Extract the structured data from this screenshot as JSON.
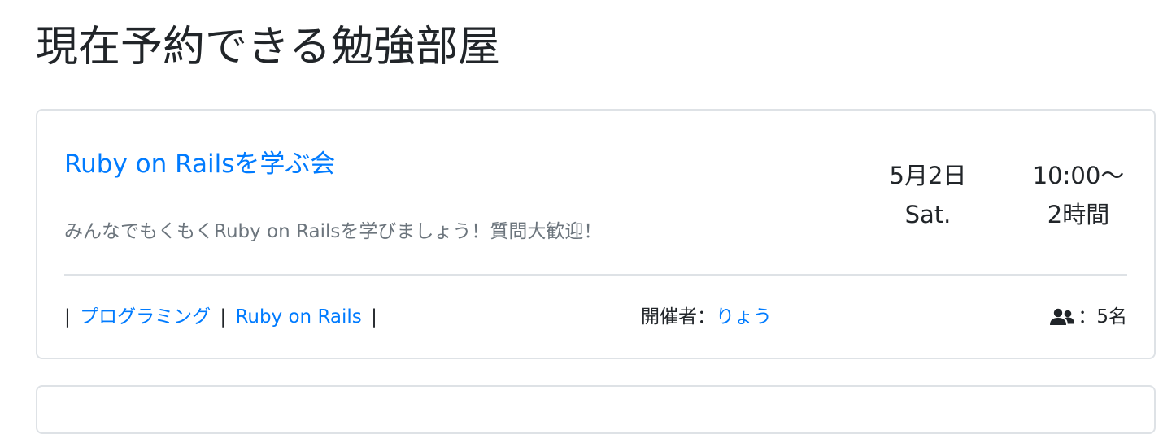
{
  "page": {
    "title": "現在予約できる勉強部屋"
  },
  "events": [
    {
      "title": "Ruby on Railsを学ぶ会",
      "description": "みんなでもくもくRuby on Railsを学びましょう！質問大歓迎！",
      "date": {
        "day": "5月2日",
        "weekday": "Sat."
      },
      "time": {
        "start": "10:00〜",
        "duration": "2時間"
      },
      "tags": [
        "プログラミング",
        "Ruby on Rails"
      ],
      "tag_separator": "|",
      "host": {
        "label": "開催者：",
        "name": "りょう"
      },
      "capacity": {
        "icon": "users-icon",
        "text": "：5名"
      }
    }
  ],
  "colors": {
    "link": "#007bff",
    "muted": "#6c757d",
    "text": "#212529",
    "border": "#dee2e6"
  }
}
